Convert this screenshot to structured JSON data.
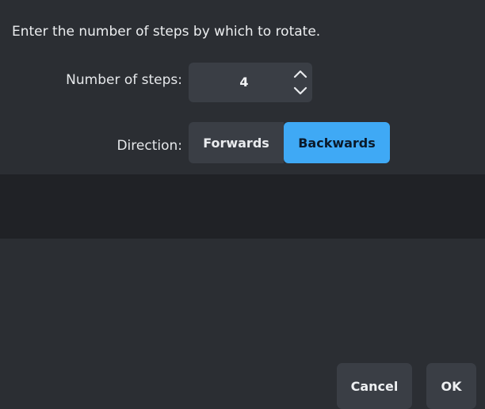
{
  "dialog": {
    "prompt": "Enter the number of steps by which to rotate."
  },
  "steps": {
    "label": "Number of steps:",
    "value": "4",
    "increment_icon": "chevron-up-icon",
    "decrement_icon": "chevron-down-icon"
  },
  "direction": {
    "label": "Direction:",
    "options": [
      "Forwards",
      "Backwards"
    ],
    "selected": "Backwards"
  },
  "footer": {
    "cancel_label": "Cancel",
    "ok_label": "OK"
  },
  "colors": {
    "background": "#2b2e33",
    "footer_background": "#202226",
    "control_background": "#3a3e45",
    "accent": "#3fa9f5"
  }
}
